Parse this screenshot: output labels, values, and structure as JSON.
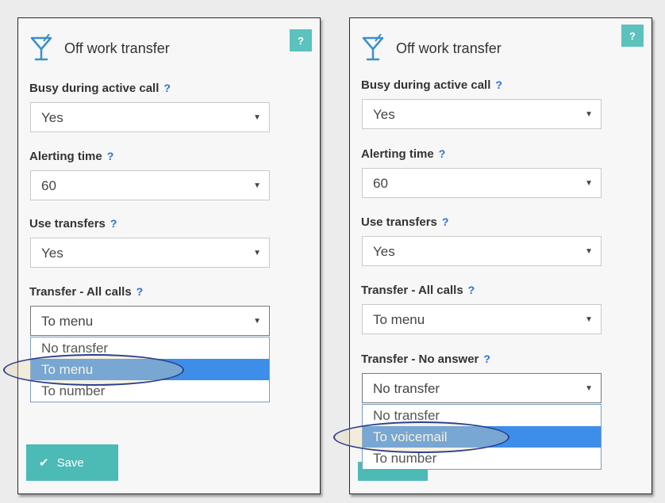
{
  "left_panel": {
    "title": "Off work transfer",
    "help_badge": "?",
    "fields": [
      {
        "label": "Busy during active call",
        "help": "?",
        "value": "Yes"
      },
      {
        "label": "Alerting time",
        "help": "?",
        "value": "60"
      },
      {
        "label": "Use transfers",
        "help": "?",
        "value": "Yes"
      },
      {
        "label": "Transfer - All calls",
        "help": "?",
        "value": "To menu"
      }
    ],
    "dropdown_options": [
      "No transfer",
      "To menu",
      "To number"
    ],
    "selected_option": "To menu",
    "save_label": "Save"
  },
  "right_panel": {
    "title": "Off work transfer",
    "help_badge": "?",
    "fields": [
      {
        "label": "Busy during active call",
        "help": "?",
        "value": "Yes"
      },
      {
        "label": "Alerting time",
        "help": "?",
        "value": "60"
      },
      {
        "label": "Use transfers",
        "help": "?",
        "value": "Yes"
      },
      {
        "label": "Transfer - All calls",
        "help": "?",
        "value": "To menu"
      },
      {
        "label": "Transfer - No answer",
        "help": "?",
        "value": "No transfer"
      }
    ],
    "dropdown_options": [
      "No transfer",
      "To voicemail",
      "To number"
    ],
    "selected_option": "To voicemail"
  },
  "colors": {
    "accent": "#4cbab5",
    "highlight": "#3d8ee8",
    "help_link": "#2a6fd6",
    "icon": "#3a90c9"
  },
  "icons": {
    "title_icon": "cocktail-glass-icon",
    "save_icon": "checkmark-icon"
  }
}
